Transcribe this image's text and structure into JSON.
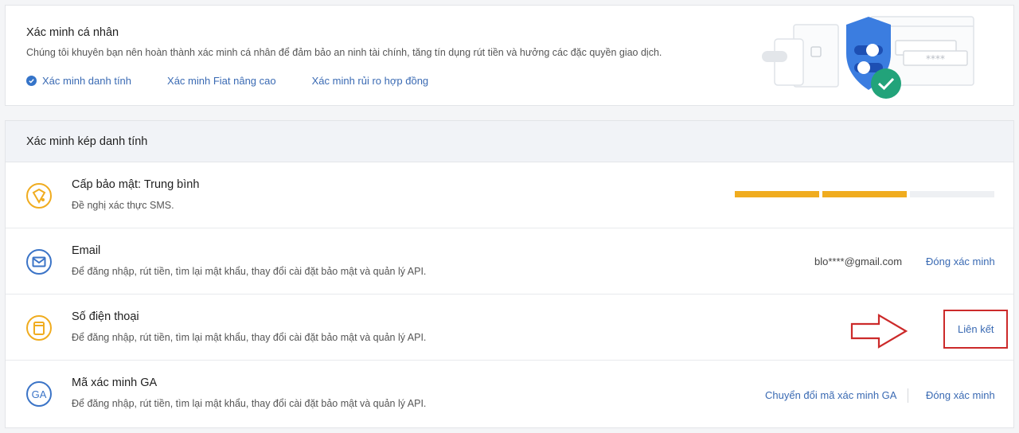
{
  "personal": {
    "title": "Xác minh cá nhân",
    "description": "Chúng tôi khuyên bạn nên hoàn thành xác minh cá nhân để đảm bảo an ninh tài chính, tăng tín dụng rút tiền và hưởng các đặc quyền giao dịch.",
    "links": [
      "Xác minh danh tính",
      "Xác minh Fiat nâng cao",
      "Xác minh rủi ro hợp đồng"
    ],
    "illustration_stars": "****"
  },
  "twofa": {
    "header": "Xác minh kép danh tính",
    "security": {
      "title": "Cấp bảo mật: Trung bình",
      "description": "Đề nghị xác thực SMS.",
      "level": 2,
      "max_level": 3,
      "level_color": "#f0ac1f",
      "empty_color": "#eef0f3"
    },
    "email": {
      "title": "Email",
      "description": "Để đăng nhập, rút tiền, tìm lại mật khẩu, thay đổi cài đặt bảo mật và quản lý API.",
      "value": "blo****@gmail.com",
      "action": "Đóng xác minh"
    },
    "phone": {
      "title": "Số điện thoại",
      "description": "Để đăng nhập, rút tiền, tìm lại mật khẩu, thay đổi cài đặt bảo mật và quản lý API.",
      "action": "Liên kết"
    },
    "ga": {
      "title": "Mã xác minh GA",
      "description": "Để đăng nhập, rút tiền, tìm lại mật khẩu, thay đổi cài đặt bảo mật và quản lý API.",
      "icon_text": "GA",
      "switch_action": "Chuyển đổi mã xác minh GA",
      "close_action": "Đóng xác minh"
    }
  },
  "icons": {
    "check": "check-circle-icon",
    "security": "shield-level-icon",
    "email": "envelope-icon",
    "phone": "phone-icon",
    "ga": "google-authenticator-icon",
    "arrow": "right-arrow-annotation-icon"
  },
  "colors": {
    "accent": "#3a6ab3",
    "warning": "#f0ac1f",
    "highlight": "#cc2a2a",
    "shield": "#3b7de0",
    "success": "#22a37a"
  }
}
